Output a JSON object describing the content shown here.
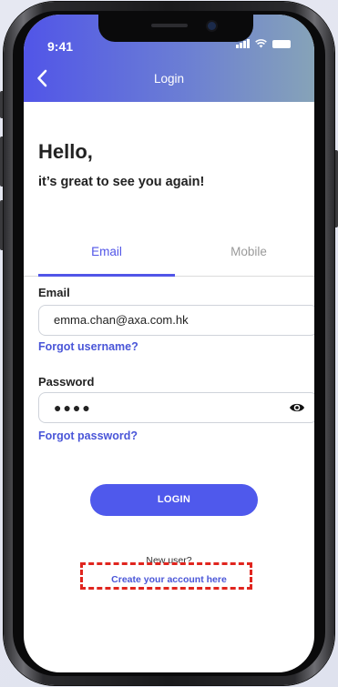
{
  "status_bar": {
    "time": "9:41"
  },
  "app_bar": {
    "title": "Login",
    "back_icon": "chevron-left-icon"
  },
  "greeting": {
    "title": "Hello,",
    "subtitle": "it’s great to see you again!"
  },
  "tabs": [
    {
      "label": "Email",
      "active": true
    },
    {
      "label": "Mobile",
      "active": false
    }
  ],
  "form": {
    "email_label": "Email",
    "email_value": "emma.chan@axa.com.hk",
    "forgot_username": "Forgot username?",
    "password_label": "Password",
    "password_value": "●●●●",
    "password_toggle_icon": "eye-icon",
    "forgot_password": "Forgot password?"
  },
  "login_button": "LOGIN",
  "signup": {
    "prompt": "New user?",
    "link": "Create your account here"
  },
  "colors": {
    "accent": "#5155e8",
    "link": "#4a56d8",
    "highlight": "#e0251e"
  }
}
